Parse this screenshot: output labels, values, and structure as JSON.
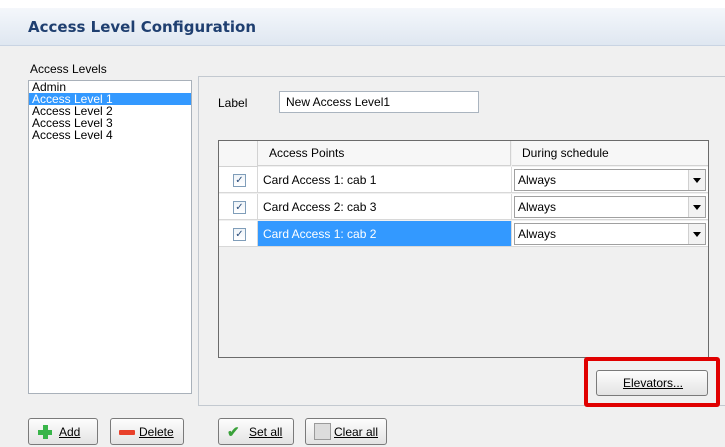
{
  "header": {
    "title": "Access Level Configuration"
  },
  "access_levels": {
    "label": "Access Levels",
    "items": [
      "Admin",
      "Access Level 1",
      "Access Level 2",
      "Access Level 3",
      "Access Level 4"
    ],
    "selected": "Access Level 1"
  },
  "detail": {
    "label_caption": "Label",
    "label_value": "New Access Level1"
  },
  "grid": {
    "columns": [
      "",
      "Access Points",
      "During schedule"
    ],
    "rows": [
      {
        "checked": true,
        "access_point": "Card Access 1: cab 1",
        "schedule": "Always"
      },
      {
        "checked": true,
        "access_point": "Card Access 2: cab 3",
        "schedule": "Always"
      },
      {
        "checked": true,
        "access_point": "Card Access 1: cab 2",
        "schedule": "Always"
      }
    ],
    "selected_row": 2
  },
  "buttons": {
    "elevators": "Elevators...",
    "add": "Add",
    "delete": "Delete",
    "set_all": "Set all",
    "clear_all": "Clear all"
  },
  "icons": {
    "add": "plus-icon",
    "delete": "minus-icon",
    "set_all": "check-icon",
    "clear_all": "clear-icon",
    "dropdown": "chevron-down-icon"
  },
  "colors": {
    "title": "#1f3f70",
    "selection": "#3399ff",
    "highlight": "#e00000"
  }
}
